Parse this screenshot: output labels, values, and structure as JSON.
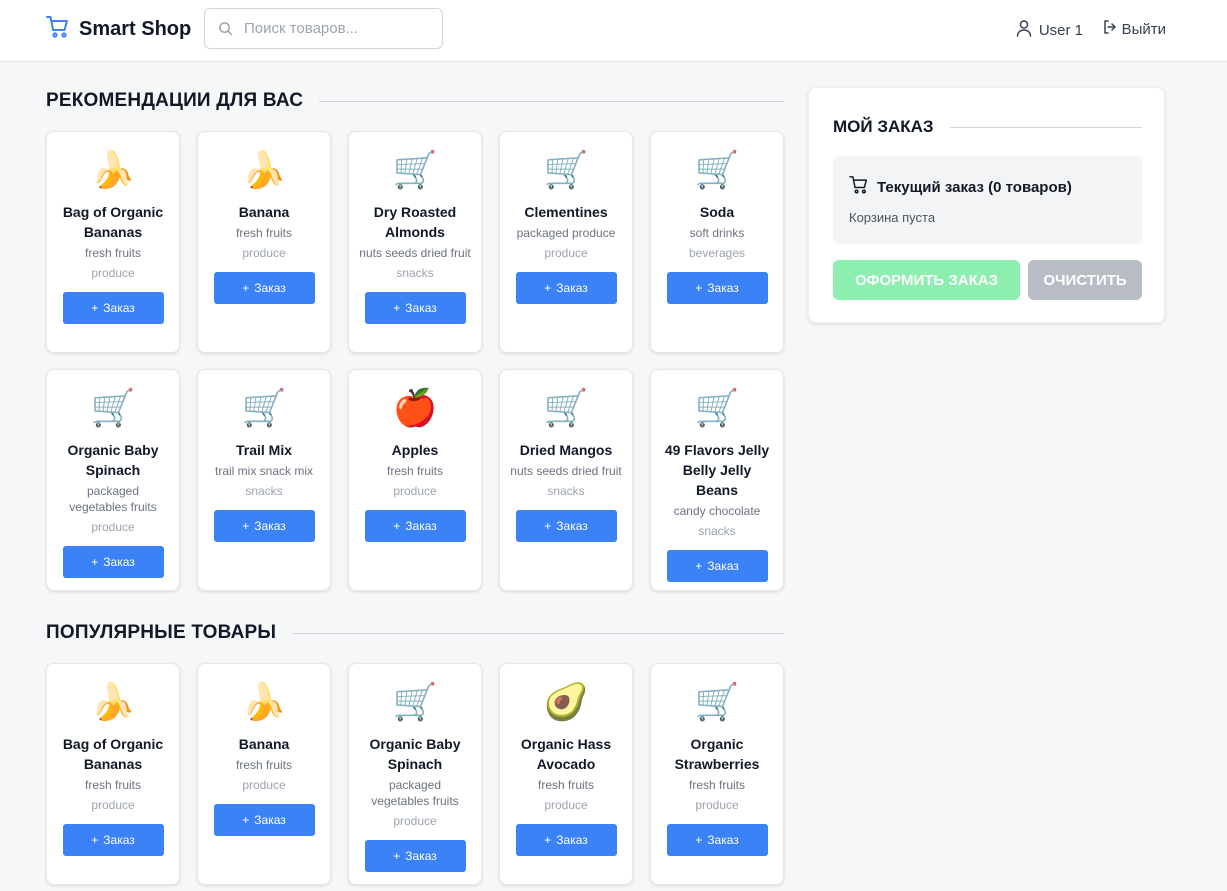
{
  "header": {
    "brand": "Smart Shop",
    "search_placeholder": "Поиск товаров...",
    "user": "User 1",
    "logout": "Выйти"
  },
  "recommendations": {
    "title": "РЕКОМЕНДАЦИИ ДЛЯ ВАС",
    "items": [
      {
        "icon": "🍌",
        "name": "Bag of Organic Bananas",
        "category": "fresh fruits",
        "department": "produce",
        "button": "Заказ"
      },
      {
        "icon": "🍌",
        "name": "Banana",
        "category": "fresh fruits",
        "department": "produce",
        "button": "Заказ"
      },
      {
        "icon": "🛒",
        "name": "Dry Roasted Almonds",
        "category": "nuts seeds dried fruit",
        "department": "snacks",
        "button": "Заказ"
      },
      {
        "icon": "🛒",
        "name": "Clementines",
        "category": "packaged produce",
        "department": "produce",
        "button": "Заказ"
      },
      {
        "icon": "🛒",
        "name": "Soda",
        "category": "soft drinks",
        "department": "beverages",
        "button": "Заказ"
      },
      {
        "icon": "🛒",
        "name": "Organic Baby Spinach",
        "category": "packaged vegetables fruits",
        "department": "produce",
        "button": "Заказ"
      },
      {
        "icon": "🛒",
        "name": "Trail Mix",
        "category": "trail mix snack mix",
        "department": "snacks",
        "button": "Заказ"
      },
      {
        "icon": "🍎",
        "name": "Apples",
        "category": "fresh fruits",
        "department": "produce",
        "button": "Заказ"
      },
      {
        "icon": "🛒",
        "name": "Dried Mangos",
        "category": "nuts seeds dried fruit",
        "department": "snacks",
        "button": "Заказ"
      },
      {
        "icon": "🛒",
        "name": "49 Flavors Jelly Belly Jelly Beans",
        "category": "candy chocolate",
        "department": "snacks",
        "button": "Заказ"
      }
    ]
  },
  "popular": {
    "title": "ПОПУЛЯРНЫЕ ТОВАРЫ",
    "items": [
      {
        "icon": "🍌",
        "name": "Bag of Organic Bananas",
        "category": "fresh fruits",
        "department": "produce",
        "button": "Заказ"
      },
      {
        "icon": "🍌",
        "name": "Banana",
        "category": "fresh fruits",
        "department": "produce",
        "button": "Заказ"
      },
      {
        "icon": "🛒",
        "name": "Organic Baby Spinach",
        "category": "packaged vegetables fruits",
        "department": "produce",
        "button": "Заказ"
      },
      {
        "icon": "🥑",
        "name": "Organic Hass Avocado",
        "category": "fresh fruits",
        "department": "produce",
        "button": "Заказ"
      },
      {
        "icon": "🛒",
        "name": "Organic Strawberries",
        "category": "fresh fruits",
        "department": "produce",
        "button": "Заказ"
      }
    ]
  },
  "order": {
    "title": "МОЙ ЗАКАЗ",
    "current": "Текущий заказ (0 товаров)",
    "empty": "Корзина пуста",
    "checkout": "ОФОРМИТЬ ЗАКАЗ",
    "clear": "ОЧИСТИТЬ"
  },
  "colors": {
    "accent": "#3b82f6",
    "checkout_disabled": "#86efac",
    "clear_disabled": "#b8bcc4"
  }
}
